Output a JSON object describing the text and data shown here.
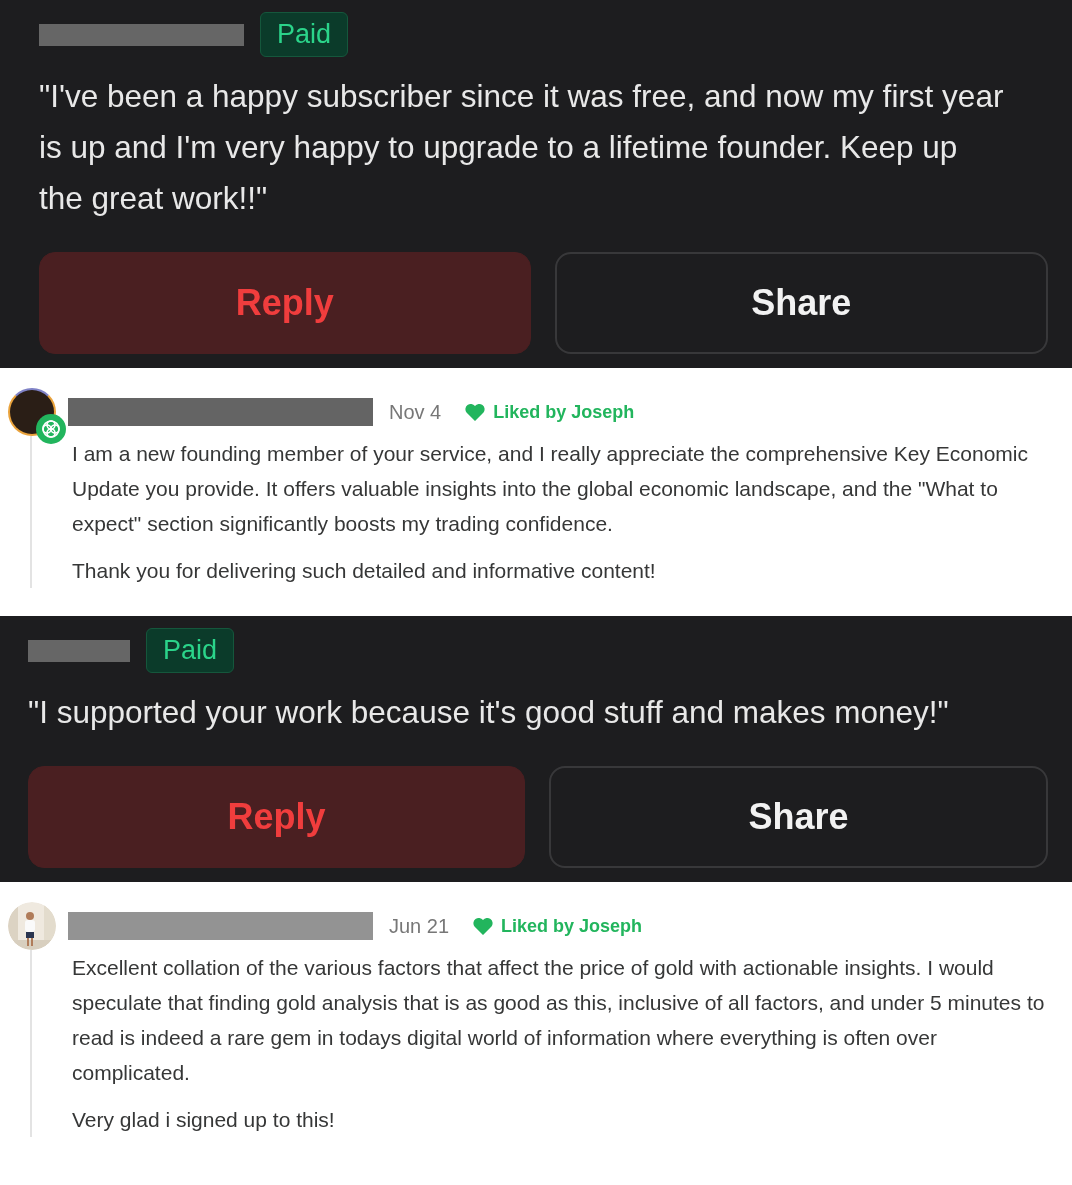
{
  "items": [
    {
      "kind": "testimonial",
      "badge": "Paid",
      "quote": "\"I've been a happy subscriber since it was free, and now my first year is up and I'm very happy to upgrade to a lifetime founder. Keep up the great work!!\"",
      "buttons": [
        {
          "label": "Reply",
          "kind": "primary"
        },
        {
          "label": "Share",
          "kind": "secondary"
        }
      ]
    },
    {
      "kind": "comment",
      "avatar": {
        "kind": "member"
      },
      "date": "Nov 4",
      "liked": "Liked by Joseph",
      "paragraphs": [
        "I am a new founding member of your service, and I really appreciate the comprehensive Key Economic Update you provide. It offers valuable insights into the global economic landscape, and the \"What to expect\" section significantly boosts my trading confidence.",
        "Thank you for delivering such detailed and informative content!"
      ]
    },
    {
      "kind": "testimonial",
      "badge": "Paid",
      "quote": "\"I supported your work because it's good stuff and makes money!\"",
      "buttons": [
        {
          "label": "Reply",
          "kind": "primary"
        },
        {
          "label": "Share",
          "kind": "secondary"
        }
      ]
    },
    {
      "kind": "comment",
      "date": "Jun 21",
      "liked": "Liked by Joseph",
      "paragraphs": [
        "Excellent collation of the various factors that affect the price of gold with actionable insights. I would speculate that finding gold analysis that is as good as this, inclusive of all factors, and under 5 minutes to read is indeed a rare gem in todays digital world of information where everything is often over complicated.",
        "Very glad i signed up to this!"
      ]
    }
  ]
}
